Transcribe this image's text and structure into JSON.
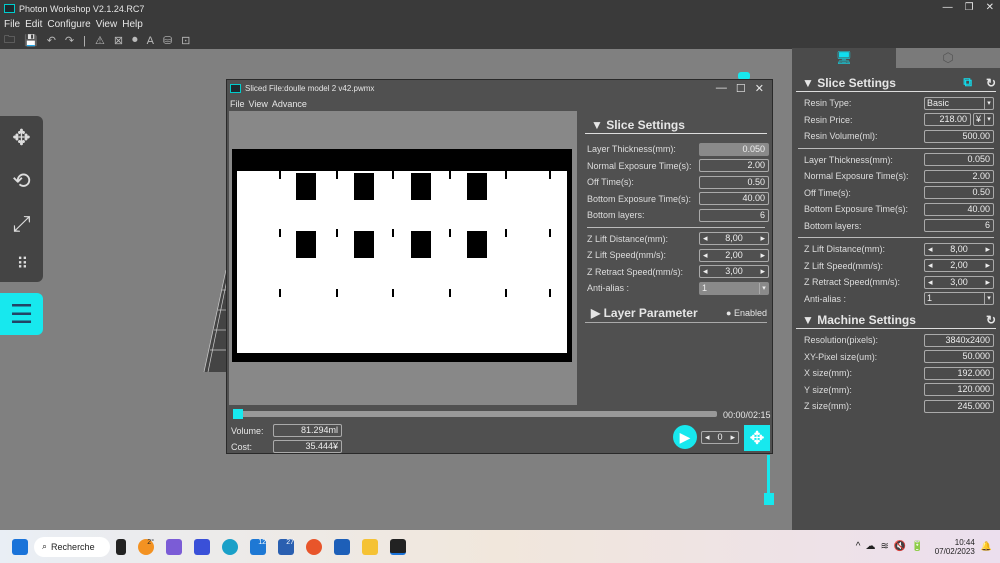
{
  "app": {
    "title": "Photon Workshop V2.1.24.RC7",
    "menu": [
      "File",
      "Edit",
      "Configure",
      "View",
      "Help"
    ],
    "toolbar_icons": [
      "open-folder-icon",
      "save-icon",
      "undo-icon",
      "redo-icon",
      "support-icon",
      "hollow-icon",
      "punch-icon",
      "text-icon",
      "slice-icon",
      "fit-icon"
    ]
  },
  "dialog": {
    "title": "Sliced File:doulle model 2 v42.pwmx",
    "menu": [
      "File",
      "View",
      "Advance"
    ],
    "slice_settings": {
      "header": "Slice Settings",
      "fields": [
        {
          "label": "Layer Thickness(mm):",
          "value": "0.050",
          "type": "disabled"
        },
        {
          "label": "Normal Exposure Time(s):",
          "value": "2.00"
        },
        {
          "label": "Off Time(s):",
          "value": "0.50"
        },
        {
          "label": "Bottom Exposure Time(s):",
          "value": "40.00"
        },
        {
          "label": "Bottom layers:",
          "value": "6"
        }
      ],
      "fields2": [
        {
          "label": "Z Lift Distance(mm):",
          "value": "8,00",
          "type": "spin"
        },
        {
          "label": "Z Lift Speed(mm/s):",
          "value": "2,00",
          "type": "spin"
        },
        {
          "label": "Z Retract Speed(mm/s):",
          "value": "3,00",
          "type": "spin"
        },
        {
          "label": "Anti-alias :",
          "value": "1",
          "type": "seldis"
        }
      ]
    },
    "layer_parameter": {
      "header": "Layer Parameter",
      "toggle": "Enabled"
    },
    "time": "00:00/02:15",
    "layer_progress": 0,
    "volume_label": "Volume:",
    "volume": "81.294ml",
    "cost_label": "Cost:",
    "cost": "35.444¥",
    "layer": "0"
  },
  "panel": {
    "slice_header": "Slice Settings",
    "resin": [
      {
        "label": "Resin Type:",
        "value": "Basic",
        "type": "sel"
      },
      {
        "label": "Resin Price:",
        "value": "218.00",
        "currency": "¥",
        "type": "price"
      },
      {
        "label": "Resin Volume(ml):",
        "value": "500.00"
      }
    ],
    "fields": [
      {
        "label": "Layer Thickness(mm):",
        "value": "0.050"
      },
      {
        "label": "Normal Exposure Time(s):",
        "value": "2.00"
      },
      {
        "label": "Off Time(s):",
        "value": "0.50"
      },
      {
        "label": "Bottom Exposure Time(s):",
        "value": "40.00"
      },
      {
        "label": "Bottom layers:",
        "value": "6"
      }
    ],
    "fields2": [
      {
        "label": "Z Lift Distance(mm):",
        "value": "8,00",
        "type": "spin"
      },
      {
        "label": "Z Lift Speed(mm/s):",
        "value": "2,00",
        "type": "spin"
      },
      {
        "label": "Z Retract Speed(mm/s):",
        "value": "3,00",
        "type": "spin"
      },
      {
        "label": "Anti-alias :",
        "value": "1",
        "type": "sel"
      }
    ],
    "machine_header": "Machine Settings",
    "machine": [
      {
        "label": "Resolution(pixels):",
        "value": "3840x2400"
      },
      {
        "label": "XY-Pixel size(um):",
        "value": "50.000"
      },
      {
        "label": "X size(mm):",
        "value": "192.000"
      },
      {
        "label": "Y size(mm):",
        "value": "120.000"
      },
      {
        "label": "Z size(mm):",
        "value": "245.000"
      }
    ]
  },
  "taskbar": {
    "search": "Recherche",
    "weather": "2°",
    "badge_mail": "12",
    "badge_teams": "27",
    "time": "10:44",
    "date": "07/02/2023"
  },
  "colors": {
    "accent": "#17e8ee"
  }
}
